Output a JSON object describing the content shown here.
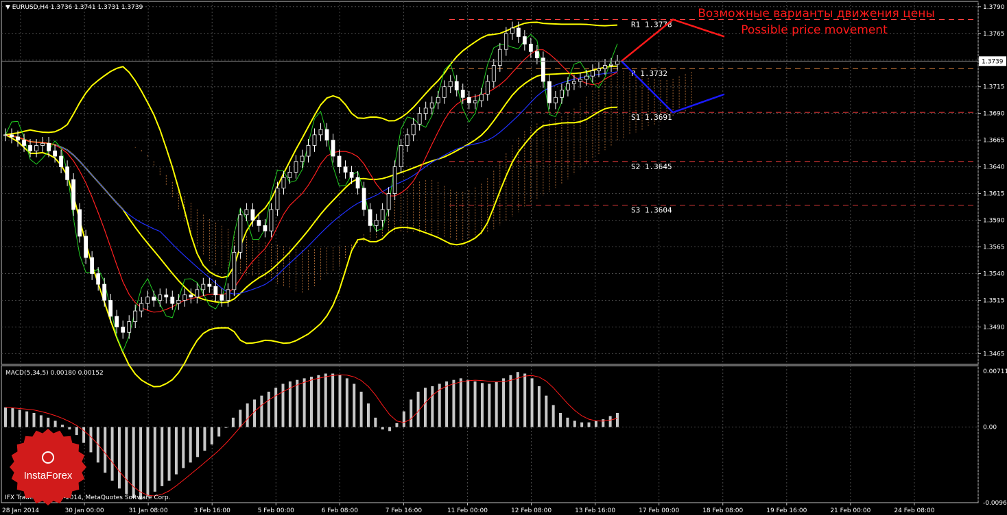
{
  "chart_data": [
    {
      "type": "candlestick",
      "title": "EURUSD,H4",
      "ohlc_header": "1.3736 1.3741 1.3731 1.3739",
      "last_price": "1.3739",
      "ylim": [
        1.3455,
        1.3795
      ],
      "y_ticks": [
        "1.3790",
        "1.3765",
        "1.3740",
        "1.3715",
        "1.3690",
        "1.3665",
        "1.3640",
        "1.3615",
        "1.3590",
        "1.3565",
        "1.3540",
        "1.3515",
        "1.3490",
        "1.3465"
      ],
      "x_ticks": [
        "28 Jan 2014",
        "30 Jan 00:00",
        "31 Jan 08:00",
        "3 Feb 16:00",
        "5 Feb 00:00",
        "6 Feb 08:00",
        "7 Feb 16:00",
        "11 Feb 00:00",
        "12 Feb 08:00",
        "13 Feb 16:00",
        "17 Feb 00:00",
        "18 Feb 08:00",
        "19 Feb 16:00",
        "21 Feb 00:00",
        "24 Feb 08:00"
      ],
      "pivot_levels": [
        {
          "label": "R1",
          "value": "1.3778",
          "color": "#ff4040"
        },
        {
          "label": "P",
          "value": "1.3732",
          "color": "#ff9a4a"
        },
        {
          "label": "S1",
          "value": "1.3691",
          "color": "#ff4040"
        },
        {
          "label": "S2",
          "value": "1.3645",
          "color": "#ff4040"
        },
        {
          "label": "S3",
          "value": "1.3604",
          "color": "#ff4040"
        }
      ],
      "close_series": [
        1.367,
        1.3668,
        1.3665,
        1.366,
        1.3655,
        1.366,
        1.3662,
        1.3655,
        1.365,
        1.364,
        1.3628,
        1.36,
        1.3575,
        1.3555,
        1.354,
        1.353,
        1.3515,
        1.35,
        1.349,
        1.3485,
        1.3495,
        1.3505,
        1.3512,
        1.3518,
        1.3515,
        1.352,
        1.3518,
        1.3512,
        1.3515,
        1.352,
        1.3518,
        1.3525,
        1.353,
        1.3528,
        1.352,
        1.3515,
        1.3525,
        1.356,
        1.3595,
        1.36,
        1.359,
        1.3585,
        1.358,
        1.36,
        1.362,
        1.363,
        1.3635,
        1.3645,
        1.365,
        1.366,
        1.367,
        1.3675,
        1.3665,
        1.365,
        1.364,
        1.3635,
        1.363,
        1.362,
        1.36,
        1.3585,
        1.359,
        1.36,
        1.3615,
        1.364,
        1.366,
        1.367,
        1.368,
        1.369,
        1.3695,
        1.37,
        1.3705,
        1.3715,
        1.372,
        1.3712,
        1.3705,
        1.37,
        1.3702,
        1.3708,
        1.372,
        1.3735,
        1.375,
        1.3765,
        1.377,
        1.3762,
        1.3755,
        1.3748,
        1.3742,
        1.372,
        1.37,
        1.3705,
        1.3712,
        1.3718,
        1.372,
        1.3722,
        1.3725,
        1.373,
        1.3732,
        1.3735,
        1.3736,
        1.3739
      ],
      "bollinger": {
        "color": "#ffff00"
      },
      "ichimoku_cloud_color": "#c87b3c",
      "forecast_paths": [
        {
          "name": "up",
          "color": "#ff1a1a",
          "points": [
            [
              0,
              1.3739
            ],
            [
              1,
              1.3778
            ],
            [
              2,
              1.3762
            ]
          ]
        },
        {
          "name": "down",
          "color": "#1a1aff",
          "points": [
            [
              0,
              1.3739
            ],
            [
              1,
              1.3691
            ],
            [
              2,
              1.3708
            ]
          ]
        }
      ],
      "annotations": [
        "Возможные варианты движения цены",
        "Possible price movement"
      ]
    },
    {
      "type": "bar",
      "title": "MACD(5,34,5) 0.00180 0.00152",
      "ylim": [
        -0.0096,
        0.0078
      ],
      "y_ticks": [
        "0.00711",
        "0.00",
        "-0.0096"
      ],
      "histogram_color": "#c8c8c8",
      "signal_color": "#ff1a1a",
      "values": [
        0.0025,
        0.0024,
        0.0022,
        0.002,
        0.0018,
        0.0015,
        0.0012,
        0.0008,
        0.0003,
        -0.0003,
        -0.001,
        -0.002,
        -0.0032,
        -0.0045,
        -0.0058,
        -0.0068,
        -0.0078,
        -0.0085,
        -0.009,
        -0.0092,
        -0.0088,
        -0.0082,
        -0.0075,
        -0.0068,
        -0.006,
        -0.0052,
        -0.0045,
        -0.0038,
        -0.003,
        -0.0022,
        -0.0012,
        0.0,
        0.0012,
        0.0022,
        0.003,
        0.0035,
        0.004,
        0.0045,
        0.005,
        0.0055,
        0.0058,
        0.006,
        0.0062,
        0.0064,
        0.0066,
        0.0068,
        0.0068,
        0.0066,
        0.0062,
        0.0055,
        0.0045,
        0.003,
        0.0012,
        -0.0003,
        -0.0005,
        0.0005,
        0.002,
        0.0035,
        0.0045,
        0.005,
        0.0052,
        0.0055,
        0.0058,
        0.006,
        0.0062,
        0.006,
        0.0058,
        0.0056,
        0.0055,
        0.0058,
        0.0062,
        0.0066,
        0.007,
        0.0068,
        0.0062,
        0.0052,
        0.004,
        0.0028,
        0.0018,
        0.0012,
        0.0008,
        0.0006,
        0.0006,
        0.0008,
        0.001,
        0.0014,
        0.0018
      ]
    }
  ],
  "footer": "IFX Trader, © 2001-2014, MetaQuotes Software Corp.",
  "logo": {
    "text": "InstaForex"
  }
}
